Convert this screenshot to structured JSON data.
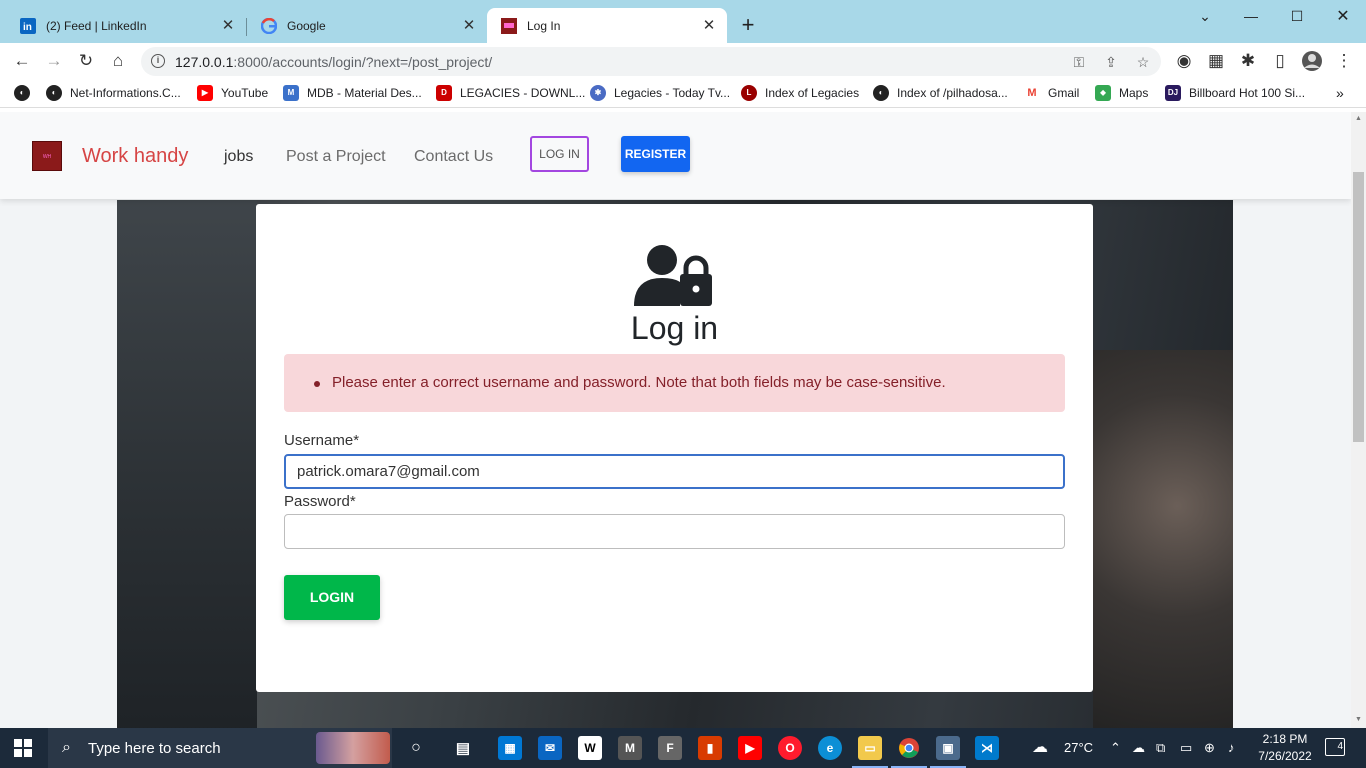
{
  "browser": {
    "tabs": [
      {
        "title": "(2) Feed | LinkedIn",
        "icon": "linkedin-icon"
      },
      {
        "title": "Google",
        "icon": "google-icon"
      },
      {
        "title": "Log In",
        "icon": "site-favicon"
      }
    ],
    "url_host": "127.0.0.1",
    "url_rest": ":8000/accounts/login/?next=/post_project/",
    "bookmarks": [
      {
        "label": "Net-Informations.C...",
        "color": "#222222"
      },
      {
        "label": "YouTube",
        "color": "#ff0000"
      },
      {
        "label": "MDB - Material Des...",
        "color": "#3b71ca"
      },
      {
        "label": "LEGACIES - DOWNL...",
        "color": "#cc0000"
      },
      {
        "label": "Legacies - Today Tv...",
        "color": "#4a6bc4"
      },
      {
        "label": "Index of Legacies",
        "color": "#990000"
      },
      {
        "label": "Index of /pilhadosa...",
        "color": "#222222"
      },
      {
        "label": "Gmail",
        "color": "#ea4335"
      },
      {
        "label": "Maps",
        "color": "#34a853"
      },
      {
        "label": "Billboard Hot 100 Si...",
        "color": "#2a1a5e"
      }
    ]
  },
  "site": {
    "brand": "Work handy",
    "nav": [
      "jobs",
      "Post a Project",
      "Contact Us"
    ],
    "login_button": "LOG IN",
    "register_button": "REGISTER"
  },
  "login": {
    "title": "Log in",
    "error": "Please enter a correct username and password. Note that both fields may be case-sensitive.",
    "username_label": "Username*",
    "username_value": "patrick.omara7@gmail.com",
    "password_label": "Password*",
    "password_value": "",
    "submit": "LOGIN"
  },
  "taskbar": {
    "search_placeholder": "Type here to search",
    "weather": "27°C",
    "time": "2:18 PM",
    "date": "7/26/2022",
    "notifications": "4"
  },
  "colors": {
    "brand": "#d64545",
    "primary": "#1266f1",
    "success": "#00b74a",
    "alert_bg": "#f8d7da",
    "alert_text": "#842029"
  }
}
